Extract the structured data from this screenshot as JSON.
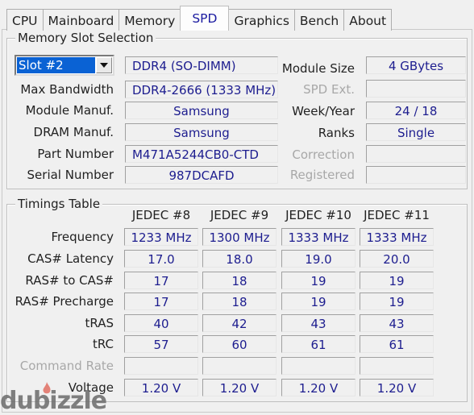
{
  "tabs": [
    {
      "label": "CPU",
      "active": false
    },
    {
      "label": "Mainboard",
      "active": false
    },
    {
      "label": "Memory",
      "active": false
    },
    {
      "label": "SPD",
      "active": true
    },
    {
      "label": "Graphics",
      "active": false
    },
    {
      "label": "Bench",
      "active": false
    },
    {
      "label": "About",
      "active": false
    }
  ],
  "slot_group": {
    "title": "Memory Slot Selection",
    "slot_select": {
      "value": "Slot #2"
    },
    "memory_type": "DDR4 (SO-DIMM)",
    "left_rows": [
      {
        "label": "Max Bandwidth",
        "value": "DDR4-2666 (1333 MHz)"
      },
      {
        "label": "Module Manuf.",
        "value": "Samsung"
      },
      {
        "label": "DRAM Manuf.",
        "value": "Samsung"
      },
      {
        "label": "Part Number",
        "value": "M471A5244CB0-CTD"
      },
      {
        "label": "Serial Number",
        "value": "987DCAFD"
      }
    ],
    "right_rows": [
      {
        "label": "Module Size",
        "value": "4 GBytes",
        "enabled": true
      },
      {
        "label": "SPD Ext.",
        "value": "",
        "enabled": false
      },
      {
        "label": "Week/Year",
        "value": "24 / 18",
        "enabled": true
      },
      {
        "label": "Ranks",
        "value": "Single",
        "enabled": true
      },
      {
        "label": "Correction",
        "value": "",
        "enabled": false
      },
      {
        "label": "Registered",
        "value": "",
        "enabled": false
      }
    ]
  },
  "timings": {
    "title": "Timings Table",
    "columns": [
      "JEDEC #8",
      "JEDEC #9",
      "JEDEC #10",
      "JEDEC #11"
    ],
    "rows": [
      {
        "label": "Frequency",
        "values": [
          "1233 MHz",
          "1300 MHz",
          "1333 MHz",
          "1333 MHz"
        ],
        "enabled": true
      },
      {
        "label": "CAS# Latency",
        "values": [
          "17.0",
          "18.0",
          "19.0",
          "20.0"
        ],
        "enabled": true
      },
      {
        "label": "RAS# to CAS#",
        "values": [
          "17",
          "18",
          "19",
          "19"
        ],
        "enabled": true
      },
      {
        "label": "RAS# Precharge",
        "values": [
          "17",
          "18",
          "19",
          "19"
        ],
        "enabled": true
      },
      {
        "label": "tRAS",
        "values": [
          "40",
          "42",
          "43",
          "43"
        ],
        "enabled": true
      },
      {
        "label": "tRC",
        "values": [
          "57",
          "60",
          "61",
          "61"
        ],
        "enabled": true
      },
      {
        "label": "Command Rate",
        "values": [
          "",
          "",
          "",
          ""
        ],
        "enabled": false
      },
      {
        "label": "Voltage",
        "values": [
          "1.20 V",
          "1.20 V",
          "1.20 V",
          "1.20 V"
        ],
        "enabled": true
      }
    ]
  },
  "watermark": "dubizzle"
}
